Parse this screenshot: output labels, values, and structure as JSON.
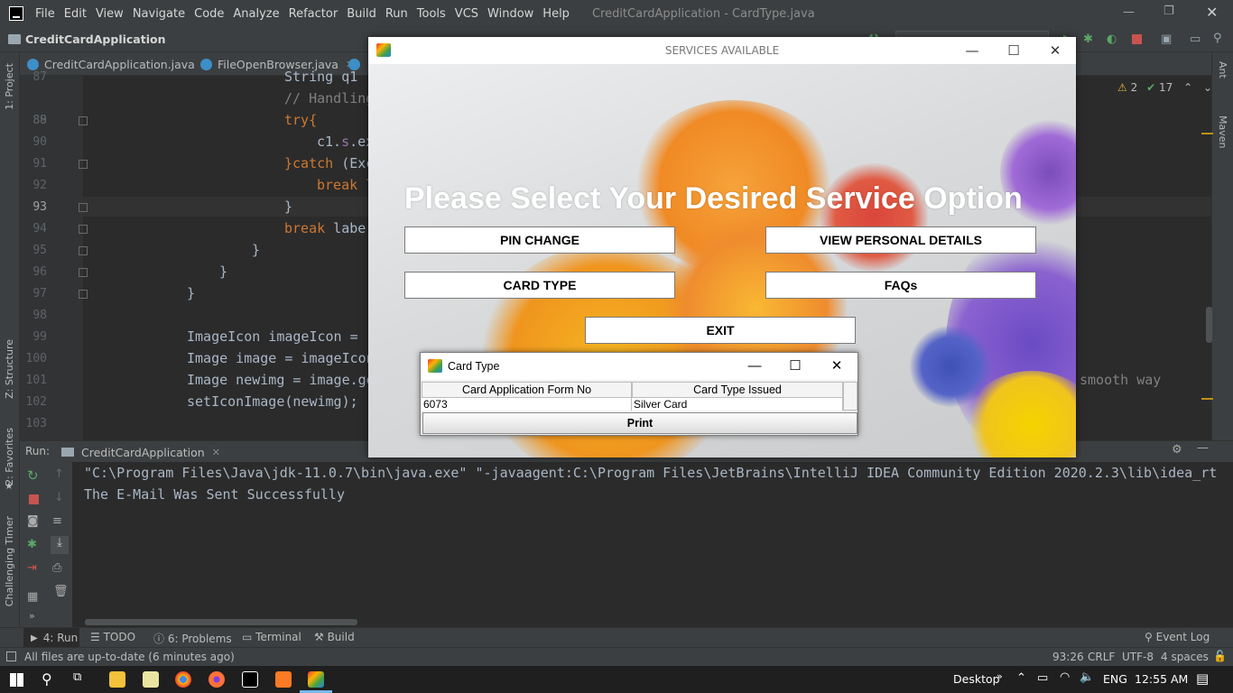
{
  "menubar": {
    "items": [
      "File",
      "Edit",
      "View",
      "Navigate",
      "Code",
      "Analyze",
      "Refactor",
      "Build",
      "Run",
      "Tools",
      "VCS",
      "Window",
      "Help"
    ],
    "window_title": "CreditCardApplication - CardType.java"
  },
  "navbar": {
    "project": "CreditCardApplication"
  },
  "editor_tabs": [
    "CreditCardApplication.java",
    "FileOpenBrowser.java"
  ],
  "left_tools": {
    "project": "1: Project",
    "structure": "Z: Structure",
    "favorites": "2: Favorites",
    "challenge": "Challenging Timer"
  },
  "right_tools": {
    "ant": "Ant",
    "maven": "Maven"
  },
  "inspections": {
    "warnings": "2",
    "ok": "17"
  },
  "code": {
    "line_numbers": [
      "87",
      "88",
      "89",
      "90",
      "91",
      "92",
      "93",
      "94",
      "95",
      "96",
      "97",
      "98",
      "99",
      "100",
      "101",
      "102",
      "103"
    ],
    "l87": "String q1",
    "l88": "// Handling",
    "l89": "try{",
    "l90_a": "c1.",
    "l90_b": "s",
    "l90_c": ".ex",
    "l91_a": "}catch",
    "l91_b": " (Exc",
    "l92": "break l",
    "l93": "}",
    "l94_a": "break",
    "l94_b": " labe",
    "l95": "}",
    "l96": "}",
    "l97": "}",
    "l99": "ImageIcon imageIcon = ",
    "l100": "Image image = imageIcon",
    "l101": "Image newimg = image.ge",
    "l101_tail": "smooth way",
    "l102": "setIconImage(newimg);"
  },
  "run": {
    "label": "Run:",
    "config": "CreditCardApplication",
    "console_line1": "\"C:\\Program Files\\Java\\jdk-11.0.7\\bin\\java.exe\" \"-javaagent:C:\\Program Files\\JetBrains\\IntelliJ IDEA Community Edition 2020.2.3\\lib\\idea_rt",
    "console_line2": "The E-Mail Was Sent Successfully"
  },
  "bottom_tabs": {
    "run": "4: Run",
    "todo": "TODO",
    "problems": "6: Problems",
    "terminal": "Terminal",
    "build": "Build",
    "event_log": "Event Log"
  },
  "status": {
    "message": "All files are up-to-date (6 minutes ago)",
    "position": "93:26",
    "line_sep": "CRLF",
    "encoding": "UTF-8",
    "indent": "4 spaces"
  },
  "taskbar": {
    "desktop": "Desktop",
    "lang": "ENG",
    "time": "12:55 AM"
  },
  "services_window": {
    "title": "SERVICES AVAILABLE",
    "headline": "Please Select Your Desired Service Option",
    "btn_pin": "PIN CHANGE",
    "btn_details": "VIEW PERSONAL DETAILS",
    "btn_card": "CARD TYPE",
    "btn_faqs": "FAQs",
    "btn_exit": "EXIT"
  },
  "card_window": {
    "title": "Card Type",
    "col1": "Card Application Form No",
    "col2": "Card Type Issued",
    "row1_col1": "6073",
    "row1_col2": "Silver Card",
    "print": "Print"
  },
  "colors": {
    "ide_bg": "#2b2b2b",
    "keyword": "#cc7832",
    "field": "#9876aa"
  }
}
